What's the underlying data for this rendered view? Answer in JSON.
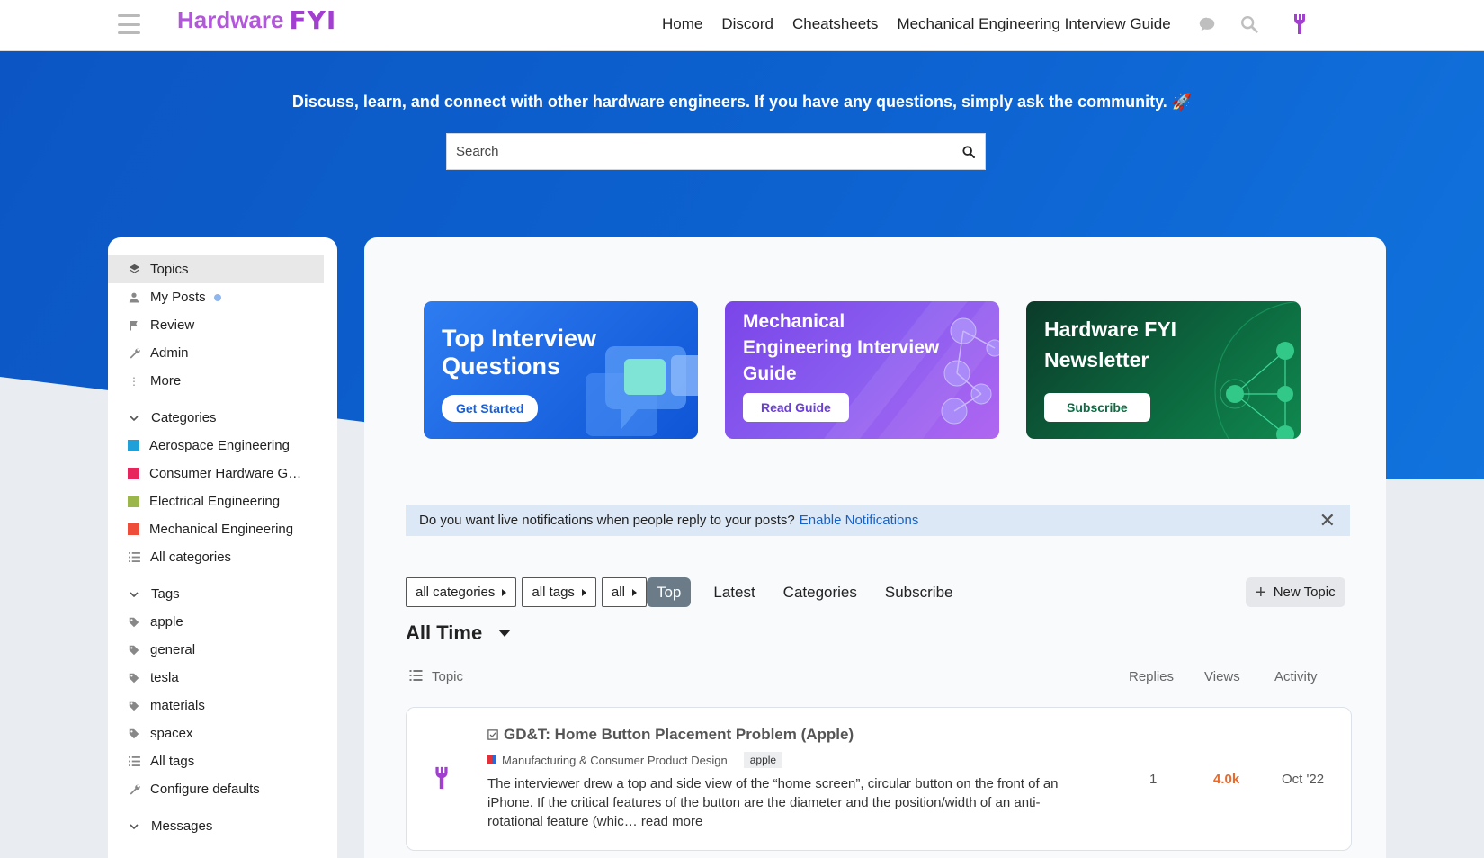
{
  "header": {
    "logo_text": "Hardware",
    "logo_accent": "FYI",
    "nav": [
      "Home",
      "Discord",
      "Cheatsheets",
      "Mechanical Engineering Interview Guide"
    ]
  },
  "hero": {
    "tagline": "Discuss, learn, and connect with other hardware engineers. If you have any questions, simply ask the community. 🚀",
    "search_placeholder": "Search"
  },
  "sidebar": {
    "items": [
      {
        "label": "Topics",
        "icon": "layers-icon"
      },
      {
        "label": "My Posts",
        "icon": "user-icon"
      },
      {
        "label": "Review",
        "icon": "flag-icon"
      },
      {
        "label": "Admin",
        "icon": "wrench-icon"
      },
      {
        "label": "More",
        "icon": "ellipsis-vertical-icon"
      }
    ],
    "categories_heading": "Categories",
    "categories": [
      {
        "label": "Aerospace Engineering",
        "color": "#1fa0d8"
      },
      {
        "label": "Consumer Hardware G…",
        "color": "#e8245c"
      },
      {
        "label": "Electrical Engineering",
        "color": "#9bb64a"
      },
      {
        "label": "Mechanical Engineering",
        "color": "#ee4d3a"
      }
    ],
    "all_categories": "All categories",
    "tags_heading": "Tags",
    "tags": [
      "apple",
      "general",
      "tesla",
      "materials",
      "spacex"
    ],
    "all_tags": "All tags",
    "configure": "Configure defaults",
    "messages_heading": "Messages"
  },
  "banners": [
    {
      "title": "Top Interview Questions",
      "button": "Get Started"
    },
    {
      "title": "Mechanical Engineering Interview Guide",
      "button": "Read Guide"
    },
    {
      "title": "Hardware FYI Newsletter",
      "button": "Subscribe"
    }
  ],
  "notice": {
    "text": "Do you want live notifications when people reply to your posts?",
    "link": "Enable Notifications"
  },
  "filters": {
    "categories": "all categories",
    "tags": "all tags",
    "all": "all",
    "tabs": [
      "Top",
      "Latest",
      "Categories",
      "Subscribe"
    ],
    "new_topic": "New Topic",
    "period": "All Time"
  },
  "columns": {
    "topic": "Topic",
    "replies": "Replies",
    "views": "Views",
    "activity": "Activity"
  },
  "topics": [
    {
      "title": "GD&T: Home Button Placement Problem (Apple)",
      "category": "Manufacturing & Consumer Product Design",
      "tag": "apple",
      "excerpt": "The interviewer drew a top and side view of the “home screen”, circular button on the front of an iPhone. If the critical features of the button are the diameter and the position/width of an anti-rotational feature (whic…",
      "read_more": "read more",
      "replies": "1",
      "views": "4.0k",
      "activity": "Oct '22"
    }
  ]
}
